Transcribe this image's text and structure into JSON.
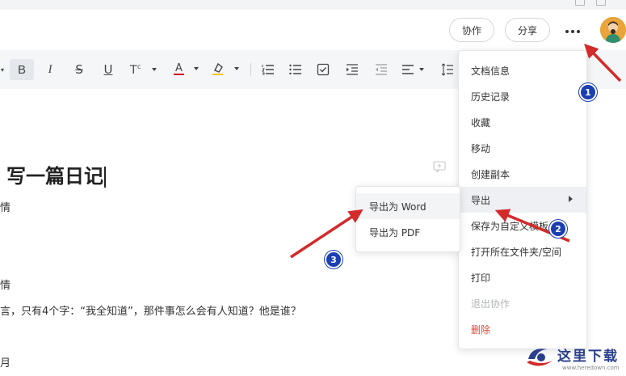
{
  "topbar": {
    "collab_label": "协作",
    "share_label": "分享",
    "more_icon": "more-horizontal-icon"
  },
  "toolbar": {
    "bold": "B",
    "italic": "I",
    "strike": "S",
    "underline": "U",
    "font_color": "A"
  },
  "document": {
    "title": "写一篇日记",
    "lines": [
      "情",
      "情",
      "言，只有4个字：“我全知道”，那件事怎么会有人知道？他是谁？",
      "月"
    ]
  },
  "menu": {
    "items": [
      {
        "label": "文档信息"
      },
      {
        "label": "历史记录"
      },
      {
        "label": "收藏"
      },
      {
        "label": "移动"
      },
      {
        "label": "创建副本"
      },
      {
        "label": "导出"
      },
      {
        "label": "保存为自定义模板"
      },
      {
        "label": "打开所在文件夹/空间"
      },
      {
        "label": "打印"
      },
      {
        "label": "退出协作"
      },
      {
        "label": "删除"
      }
    ]
  },
  "submenu": {
    "items": [
      {
        "label": "导出为 Word"
      },
      {
        "label": "导出为 PDF"
      }
    ]
  },
  "annotations": {
    "badge1": "1",
    "badge2": "2",
    "badge3": "3",
    "arrow_color": "#d32a2a",
    "badge_color": "#1b3fb3"
  },
  "watermark": {
    "text": "这里下载",
    "url": "www.heredown.com"
  },
  "colors": {
    "toolbar_bg": "#f5f6f7",
    "danger": "#e2473b",
    "highlight_yellow": "#f5c518",
    "font_red": "#d0021b"
  }
}
